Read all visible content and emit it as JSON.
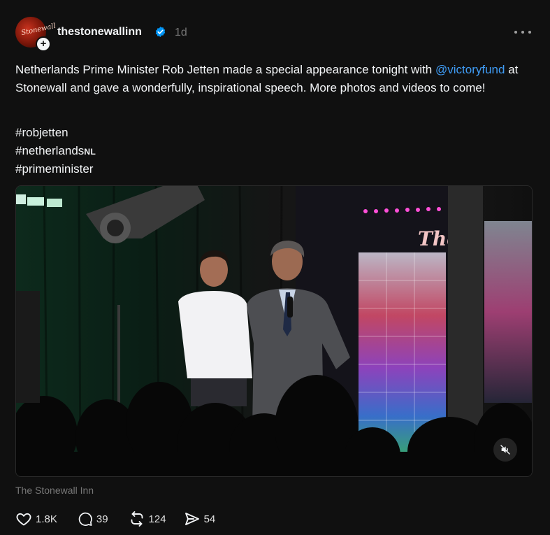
{
  "post": {
    "username": "thestonewallinn",
    "avatar_text": "Stonewall",
    "follow_badge": "+",
    "time_ago": "1d",
    "verified": true,
    "caption_part1": "Netherlands Prime Minister Rob Jetten made a special appearance tonight with ",
    "mention": "@victoryfund",
    "caption_part2": " at Stonewall and gave a wonderfully, inspirational speech. More photos and videos to come!",
    "hashtags": [
      "#robjetten",
      "#netherlands",
      "#primeminister"
    ],
    "hashtag_flag": "NL",
    "venue_sign": "TheS",
    "location": "The Stonewall Inn",
    "colors": {
      "accent": "#3f9cf5",
      "background": "#101010",
      "muted": "#777777"
    },
    "icons": {
      "more": "more-dots-icon",
      "mute": "muted-speaker-icon",
      "verified": "verified-badge-icon"
    }
  },
  "actions": {
    "likes": "1.8K",
    "comments": "39",
    "reposts": "124",
    "shares": "54"
  }
}
